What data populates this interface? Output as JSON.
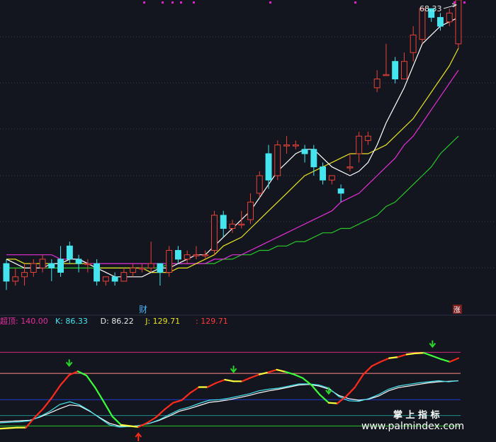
{
  "colors": {
    "background": "#14161f",
    "grid": "#3a3f50",
    "up": "#e8423a",
    "down": "#44e5ef",
    "ma5": "#ffffff",
    "ma10": "#e6e320",
    "ma20": "#e32fd8",
    "ma60": "#28c72a",
    "kdj_j_up": "#ff2a1a",
    "kdj_j_flat": "#ffff3a",
    "kdj_j_down": "#3aff3a",
    "line_overbought": "#d0287e",
    "line_upper": "#ff8a8a",
    "line_mid": "#1f3fd0",
    "line_lower": "#1f8f8a",
    "line_bottom": "#28c72a",
    "signal_down": "#2ad42a",
    "signal_up": "#ff2a1a",
    "marker": "#e020d0"
  },
  "top_panel": {
    "peak_label": "68.33",
    "event_label": "财",
    "badge_label": "涨"
  },
  "indicator_legend": [
    {
      "text": "超顶: 140.00",
      "color": "#e32fa0"
    },
    {
      "text": "K: 86.33",
      "color": "#44e5ef"
    },
    {
      "text": "D: 86.22",
      "color": "#e6e6e6"
    },
    {
      "text": "J: 129.71",
      "color": "#e6e320"
    },
    {
      "text": ": 129.71",
      "color": "#ff3a3a"
    }
  ],
  "watermark": {
    "line1": "掌 上 指 标",
    "line2": "www.palmindex.com"
  },
  "chart_data": [
    {
      "type": "candlestick",
      "title": "",
      "note": "price scale unlabeled except peak 68.33",
      "ylim": [
        4,
        72
      ],
      "candles": [
        [
          13,
          9,
          14,
          7
        ],
        [
          9,
          10,
          12,
          8
        ],
        [
          10,
          11,
          13,
          8
        ],
        [
          11,
          13,
          14,
          10
        ],
        [
          12,
          14,
          15,
          11
        ],
        [
          13,
          12,
          14,
          9
        ],
        [
          14,
          11,
          17,
          10
        ],
        [
          17,
          14,
          18,
          13
        ],
        [
          14,
          13,
          15,
          11
        ],
        [
          13,
          13,
          14,
          11
        ],
        [
          13,
          9,
          14,
          8
        ],
        [
          9,
          10,
          10,
          8
        ],
        [
          10,
          9,
          11,
          8
        ],
        [
          9,
          11,
          12,
          9
        ],
        [
          11,
          12,
          13,
          10
        ],
        [
          12,
          12,
          13,
          11
        ],
        [
          12,
          13,
          18,
          11
        ],
        [
          13,
          11,
          13,
          8
        ],
        [
          11,
          16,
          17,
          10
        ],
        [
          16,
          14,
          17,
          13
        ],
        [
          14,
          15,
          16,
          13
        ],
        [
          15,
          15,
          17,
          14
        ],
        [
          15,
          15,
          16,
          14
        ],
        [
          16,
          24,
          25,
          15
        ],
        [
          24,
          21,
          25,
          19
        ],
        [
          21,
          22,
          23,
          20
        ],
        [
          22,
          22,
          25,
          21
        ],
        [
          23,
          27,
          29,
          22
        ],
        [
          29,
          33,
          34,
          28
        ],
        [
          38,
          32,
          40,
          30
        ],
        [
          33,
          40,
          41,
          32
        ],
        [
          40,
          40,
          42,
          38
        ],
        [
          40,
          40,
          41,
          39
        ],
        [
          39,
          38,
          40,
          36
        ],
        [
          39,
          35,
          40,
          33
        ],
        [
          35,
          32,
          36,
          31
        ],
        [
          32,
          33,
          33,
          31
        ],
        [
          30,
          29,
          31,
          27
        ],
        [
          35,
          35,
          38,
          34
        ],
        [
          38,
          42,
          43,
          36
        ],
        [
          41,
          42,
          43,
          40
        ],
        [
          53,
          55,
          57,
          52
        ],
        [
          56,
          56,
          63,
          56
        ],
        [
          59,
          55,
          60,
          54
        ],
        [
          55,
          59,
          61,
          55
        ],
        [
          61,
          65,
          67,
          59
        ],
        [
          64,
          71,
          71,
          63
        ],
        [
          71,
          69,
          71,
          68
        ],
        [
          69,
          67,
          70,
          66
        ],
        [
          68,
          70,
          71,
          67
        ],
        [
          63,
          73,
          73,
          62
        ]
      ],
      "ma5": [
        14,
        13,
        12,
        12,
        12,
        13,
        13,
        14,
        14,
        13,
        12,
        11,
        10,
        10,
        10,
        10,
        11,
        12,
        12,
        13,
        14,
        15,
        15,
        17,
        19,
        21,
        23,
        25,
        28,
        31,
        34,
        36,
        38,
        39,
        39,
        37,
        35,
        34,
        33,
        34,
        36,
        40,
        45,
        49,
        53,
        58,
        63,
        65,
        67,
        68,
        69
      ],
      "ma10": [
        14,
        14,
        13,
        13,
        13,
        13,
        13,
        13,
        13,
        13,
        12,
        12,
        12,
        12,
        12,
        12,
        11,
        11,
        11,
        12,
        12,
        13,
        14,
        15,
        17,
        18,
        19,
        21,
        23,
        25,
        27,
        29,
        31,
        33,
        34,
        35,
        36,
        37,
        38,
        38,
        38,
        39,
        40,
        42,
        44,
        46,
        49,
        52,
        55,
        58,
        62
      ],
      "ma20": [
        15,
        15,
        15,
        15,
        15,
        15,
        14,
        14,
        14,
        13,
        13,
        13,
        13,
        13,
        13,
        13,
        13,
        13,
        13,
        13,
        13,
        13,
        13,
        14,
        14,
        15,
        15,
        16,
        17,
        18,
        19,
        20,
        21,
        22,
        23,
        24,
        25,
        27,
        28,
        29,
        31,
        33,
        35,
        37,
        40,
        42,
        45,
        48,
        51,
        54,
        57
      ],
      "ma60": [
        12,
        12,
        12,
        12,
        12,
        12,
        12,
        12,
        12,
        12,
        12,
        12,
        12,
        12,
        12,
        12,
        12,
        12,
        13,
        13,
        13,
        13,
        13,
        13,
        14,
        14,
        15,
        15,
        16,
        16,
        17,
        17,
        18,
        18,
        19,
        20,
        20,
        21,
        21,
        22,
        23,
        24,
        26,
        27,
        29,
        31,
        33,
        35,
        38,
        40,
        42
      ]
    },
    {
      "type": "line",
      "title": "",
      "ylim": [
        -25,
        150
      ],
      "reference_levels": [
        140,
        100,
        50,
        20,
        0
      ],
      "series": [
        {
          "name": "J",
          "values": [
            -5,
            -4,
            -3,
            -3,
            16,
            33,
            54,
            78,
            97,
            104,
            96,
            73,
            46,
            18,
            2,
            0,
            -2,
            6,
            16,
            31,
            44,
            49,
            63,
            74,
            74,
            82,
            88,
            85,
            85,
            92,
            98,
            102,
            107,
            103,
            98,
            91,
            78,
            59,
            44,
            43,
            56,
            73,
            98,
            114,
            122,
            129,
            131,
            136,
            138,
            139,
            133,
            127,
            122,
            129
          ]
        },
        {
          "name": "K",
          "values": [
            6,
            7,
            8,
            10,
            18,
            28,
            41,
            46,
            40,
            29,
            15,
            2,
            -2,
            -1,
            1,
            5,
            12,
            22,
            31,
            36,
            43,
            49,
            50,
            53,
            57,
            61,
            67,
            70,
            72,
            76,
            80,
            80,
            78,
            72,
            56,
            48,
            47,
            52,
            60,
            70,
            76,
            79,
            82,
            84,
            86,
            84,
            86
          ]
        },
        {
          "name": "D",
          "values": [
            8,
            9,
            10,
            11,
            17,
            25,
            33,
            40,
            38,
            28,
            16,
            5,
            0,
            -1,
            1,
            5,
            11,
            19,
            28,
            33,
            39,
            45,
            47,
            50,
            54,
            58,
            63,
            67,
            70,
            74,
            78,
            79,
            76,
            70,
            58,
            52,
            49,
            51,
            57,
            67,
            73,
            76,
            79,
            82,
            84,
            85,
            86
          ]
        }
      ],
      "signals": [
        {
          "type": "down",
          "index": 8
        },
        {
          "type": "down",
          "index": 27
        },
        {
          "type": "down",
          "index": 38
        },
        {
          "type": "down",
          "index": 50
        },
        {
          "type": "up",
          "index": 16
        }
      ]
    }
  ]
}
